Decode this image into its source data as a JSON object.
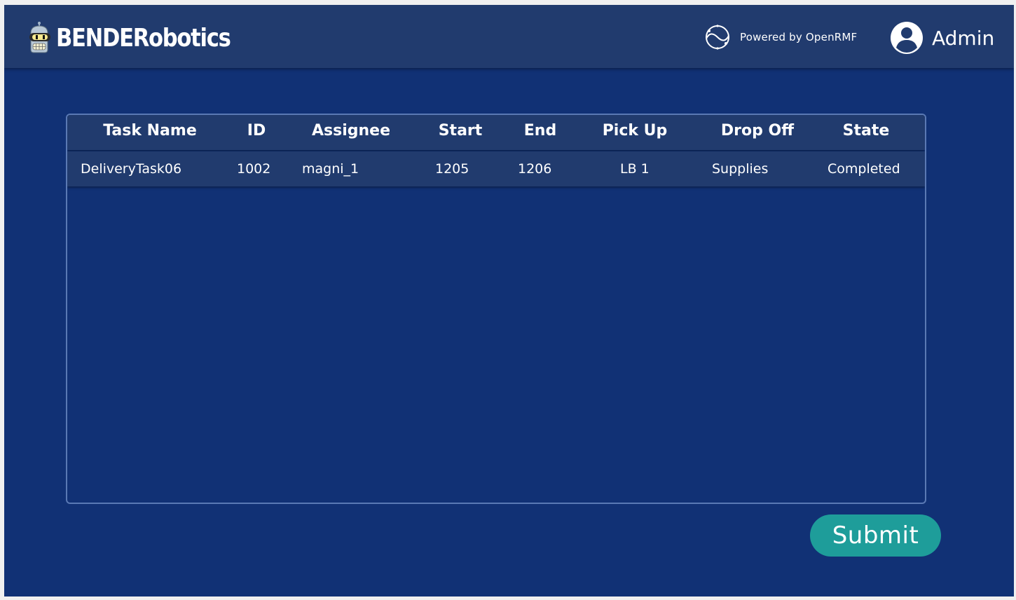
{
  "header": {
    "brand": "BENDERobotics",
    "powered_by": "Powered by OpenRMF",
    "user": "Admin"
  },
  "table": {
    "columns": [
      "Task Name",
      "ID",
      "Assignee",
      "Start",
      "End",
      "Pick Up",
      "Drop Off",
      "State"
    ],
    "rows": [
      {
        "task_name": "DeliveryTask06",
        "id": "1002",
        "assignee": "magni_1",
        "start": "1205",
        "end": "1206",
        "pick_up": "LB 1",
        "drop_off": "Supplies",
        "state": "Completed"
      }
    ]
  },
  "actions": {
    "submit_label": "Submit"
  },
  "colors": {
    "background": "#113175",
    "header": "#213b6e",
    "table_border": "#5a79b4",
    "submit": "#1e9d9a"
  }
}
